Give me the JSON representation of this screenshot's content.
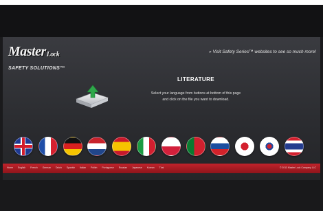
{
  "brand": {
    "logo_main": "Master",
    "logo_lock": "Lock",
    "logo_sub": "SAFETY SOLUTIONS™"
  },
  "promo_text": "» Visit Safety Series™ websites to see so much more!",
  "heading": "LITERATURE",
  "instructions": {
    "line1": "Select your language from buttons at bottom of this page",
    "line2": "and click on the file you want to download."
  },
  "flags": [
    {
      "name": "uk",
      "colors": [
        "#1f3a93",
        "#ffffff",
        "#d21c2b"
      ]
    },
    {
      "name": "france",
      "colors": [
        "#1f4ea8",
        "#ffffff",
        "#d5202f"
      ]
    },
    {
      "name": "germany",
      "colors": [
        "#111111",
        "#d8201f",
        "#f6c400"
      ]
    },
    {
      "name": "netherlands",
      "colors": [
        "#c8232c",
        "#ffffff",
        "#21468b"
      ]
    },
    {
      "name": "spain",
      "colors": [
        "#c8192b",
        "#f6c400",
        "#c8192b"
      ]
    },
    {
      "name": "italy",
      "colors": [
        "#1a9a42",
        "#ffffff",
        "#d21f2f"
      ]
    },
    {
      "name": "poland",
      "colors": [
        "#ffffff",
        "#ffffff",
        "#d3203b"
      ]
    },
    {
      "name": "portugal",
      "colors": [
        "#0a7a30",
        "#d0202e",
        "#d0202e"
      ]
    },
    {
      "name": "russia",
      "colors": [
        "#ffffff",
        "#1b4ea0",
        "#d3222a"
      ]
    },
    {
      "name": "japan",
      "colors": [
        "#ffffff",
        "#d3202e",
        "#ffffff"
      ]
    },
    {
      "name": "korea",
      "colors": [
        "#ffffff",
        "#cc2230",
        "#1f4aa0"
      ]
    },
    {
      "name": "thailand",
      "colors": [
        "#d3202e",
        "#ffffff",
        "#243c8f"
      ]
    }
  ],
  "footer": {
    "links": [
      "Home",
      "English",
      "French",
      "German",
      "Dutch",
      "Spanish",
      "Italian",
      "Polish",
      "Portuguese",
      "Russian",
      "Japanese",
      "Korean",
      "Thai"
    ],
    "copyright": "© 2013 Master Lock Company LLC"
  },
  "colors": {
    "accent_red": "#b61f26",
    "panel": "#333438",
    "icon_green": "#2fa84a"
  }
}
